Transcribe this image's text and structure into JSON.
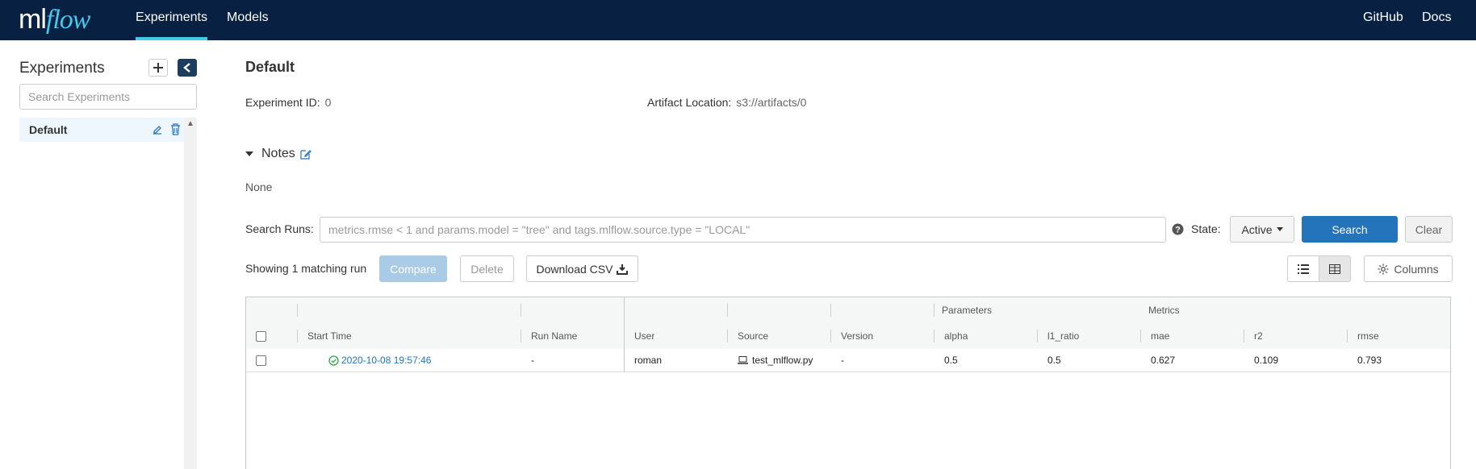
{
  "header": {
    "logo_ml": "ml",
    "logo_flow": "flow",
    "nav": [
      "Experiments",
      "Models"
    ],
    "right_links": [
      "GitHub",
      "Docs"
    ]
  },
  "sidebar": {
    "title": "Experiments",
    "search_placeholder": "Search Experiments",
    "items": [
      {
        "label": "Default"
      }
    ]
  },
  "experiment": {
    "title": "Default",
    "id_label": "Experiment ID:",
    "id_value": "0",
    "artifact_label": "Artifact Location:",
    "artifact_value": "s3://artifacts/0",
    "notes_label": "Notes",
    "notes_value": "None"
  },
  "search": {
    "label": "Search Runs:",
    "placeholder": "metrics.rmse < 1 and params.model = \"tree\" and tags.mlflow.source.type = \"LOCAL\"",
    "state_label": "State:",
    "state_value": "Active",
    "search_button": "Search",
    "clear_button": "Clear"
  },
  "runs_toolbar": {
    "count_text": "Showing 1 matching run",
    "compare": "Compare",
    "delete": "Delete",
    "download_csv": "Download CSV",
    "columns": "Columns"
  },
  "table": {
    "group_headers": {
      "parameters": "Parameters",
      "metrics": "Metrics"
    },
    "columns": [
      "Start Time",
      "Run Name",
      "User",
      "Source",
      "Version",
      "alpha",
      "l1_ratio",
      "mae",
      "r2",
      "rmse"
    ],
    "rows": [
      {
        "start_time": "2020-10-08 19:57:46",
        "run_name": "-",
        "user": "roman",
        "source": "test_mlflow.py",
        "version": "-",
        "alpha": "0.5",
        "l1_ratio": "0.5",
        "mae": "0.627",
        "r2": "0.109",
        "rmse": "0.793"
      }
    ]
  },
  "colors": {
    "header_bg": "#082142",
    "accent": "#43c9ed",
    "primary": "#2374bb",
    "status_ok": "#2ea44f"
  }
}
